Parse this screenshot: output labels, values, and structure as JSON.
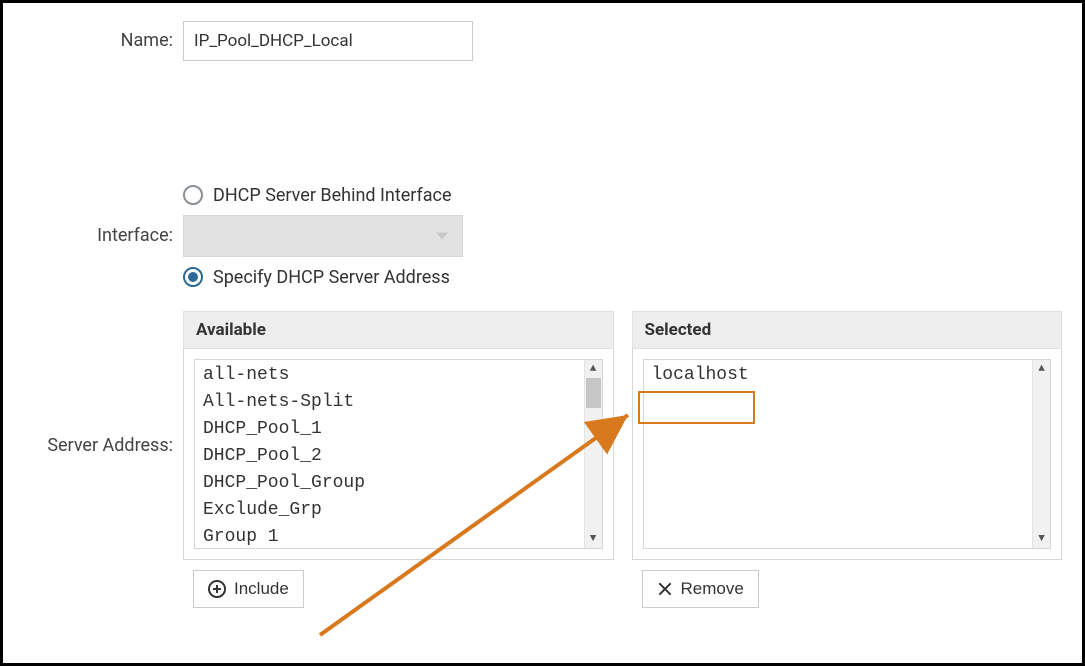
{
  "labels": {
    "name": "Name:",
    "interface": "Interface:",
    "server_address": "Server Address:"
  },
  "fields": {
    "name_value": "IP_Pool_DHCP_Local"
  },
  "radios": {
    "behind_interface": "DHCP Server Behind Interface",
    "specify_address": "Specify DHCP Server Address",
    "selected": "specify_address"
  },
  "dual_list": {
    "available_header": "Available",
    "selected_header": "Selected",
    "available_items": [
      "all-nets",
      "All-nets-Split",
      "DHCP_Pool_1",
      "DHCP_Pool_2",
      "DHCP_Pool_Group",
      "Exclude_Grp",
      "Group 1"
    ],
    "selected_items": [
      "localhost"
    ]
  },
  "buttons": {
    "include": "Include",
    "remove": "Remove"
  },
  "annotation": {
    "arrow_color": "#d9791e",
    "highlight_target": "localhost"
  }
}
